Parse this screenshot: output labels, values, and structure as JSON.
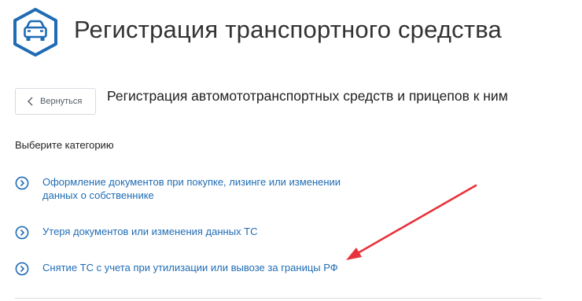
{
  "header": {
    "title": "Регистрация транспортного средства",
    "icon": "car-icon",
    "icon_color": "#1f6cb4"
  },
  "back_button": {
    "label": "Вернуться",
    "icon": "chevron-left-icon"
  },
  "section": {
    "title": "Регистрация автомототранспортных средств и прицепов к ним"
  },
  "category": {
    "heading": "Выберите категорию",
    "items": [
      {
        "label": "Оформление документов при покупке, лизинге или изменении данных о собственнике",
        "icon": "chevron-circle-right-icon"
      },
      {
        "label": "Утеря документов или изменения данных ТС",
        "icon": "chevron-circle-right-icon"
      },
      {
        "label": "Снятие ТС с учета при утилизации или вывозе за границы РФ",
        "icon": "chevron-circle-right-icon"
      }
    ]
  },
  "colors": {
    "link": "#1f6cb4",
    "annotation_arrow": "#e8323c"
  }
}
